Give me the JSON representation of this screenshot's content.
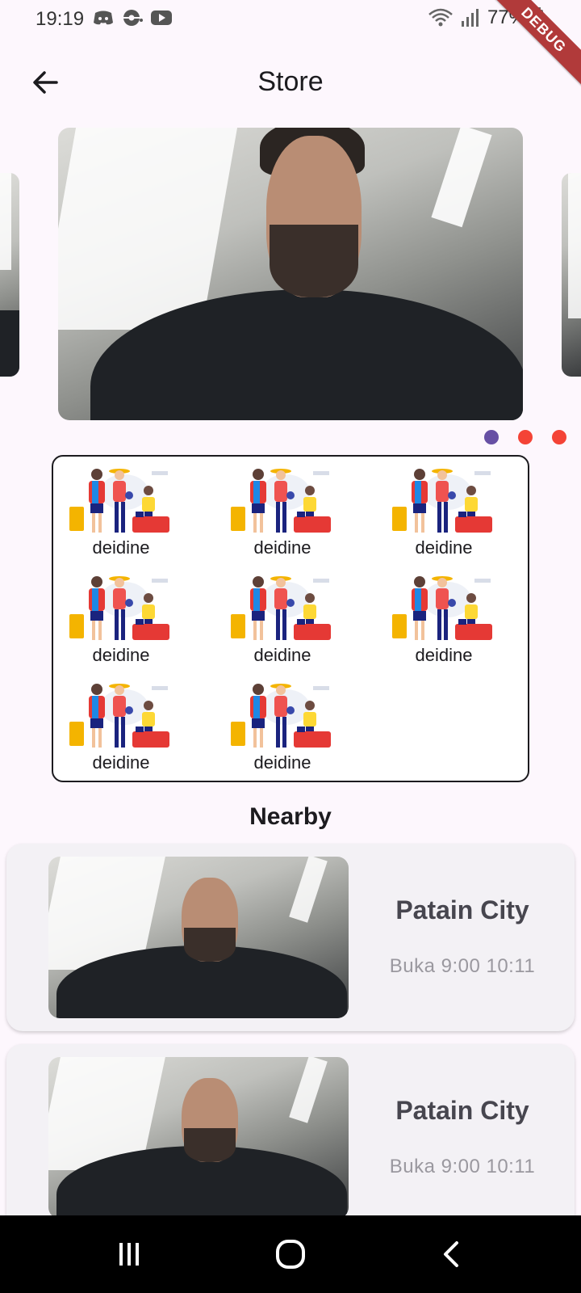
{
  "status_bar": {
    "time": "19:19",
    "battery": "77%",
    "left_icons": [
      "discord-icon",
      "pokeball-icon",
      "youtube-icon"
    ],
    "right_icons": [
      "wifi-icon",
      "signal-icon",
      "battery-icon"
    ]
  },
  "debug_banner": "DEBUG",
  "app_bar": {
    "title": "Store",
    "back_icon": "arrow-back-icon"
  },
  "carousel": {
    "page_count": 3,
    "active_index": 0,
    "active_color": "#6750a4",
    "inactive_color": "#f44336"
  },
  "categories": [
    {
      "label": "deidine"
    },
    {
      "label": "deidine"
    },
    {
      "label": "deidine"
    },
    {
      "label": "deidine"
    },
    {
      "label": "deidine"
    },
    {
      "label": "deidine"
    },
    {
      "label": "deidine"
    },
    {
      "label": "deidine"
    }
  ],
  "nearby": {
    "title": "Nearby",
    "items": [
      {
        "name": "Patain City",
        "hours": "Buka 9:00 10:11"
      },
      {
        "name": "Patain City",
        "hours": "Buka 9:00 10:11"
      }
    ]
  },
  "nav_bar": {
    "icons": [
      "recent-apps-icon",
      "home-icon",
      "back-icon"
    ]
  }
}
